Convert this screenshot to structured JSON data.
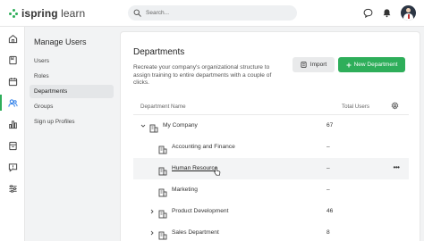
{
  "app": {
    "logo_bold": "ispring",
    "logo_light": " learn",
    "brand_color": "#2eae5a"
  },
  "search": {
    "placeholder": "Search..."
  },
  "topbar_icons": [
    "chat-icon",
    "bell-icon",
    "avatar"
  ],
  "rail": {
    "items": [
      "home-icon",
      "courses-icon",
      "calendar-icon",
      "users-icon",
      "reports-icon",
      "library-icon",
      "feedback-icon",
      "settings-sliders-icon"
    ],
    "active_index": 3
  },
  "subnav": {
    "title": "Manage Users",
    "items": [
      {
        "label": "Users"
      },
      {
        "label": "Roles"
      },
      {
        "label": "Departments",
        "active": true
      },
      {
        "label": "Groups"
      },
      {
        "label": "Sign up Profiles"
      }
    ]
  },
  "main": {
    "title": "Departments",
    "description": "Recreate your company's organizational structure to assign training to entire departments with a couple of clicks.",
    "import_label": "Import",
    "new_label": "New Department",
    "columns": {
      "name": "Department Name",
      "total": "Total Users"
    },
    "rows": [
      {
        "name": "My Company",
        "total": "67",
        "expander": "chevron-down-icon"
      },
      {
        "name": "Accounting and Finance",
        "total": "–"
      },
      {
        "name": "Human Resource",
        "total": "–",
        "hovered": true,
        "more": "•••"
      },
      {
        "name": "Marketing",
        "total": "–"
      },
      {
        "name": "Product Development",
        "total": "46",
        "expander": "chevron-right-icon"
      },
      {
        "name": "Sales Department",
        "total": "8",
        "expander": "chevron-right-icon"
      }
    ]
  }
}
